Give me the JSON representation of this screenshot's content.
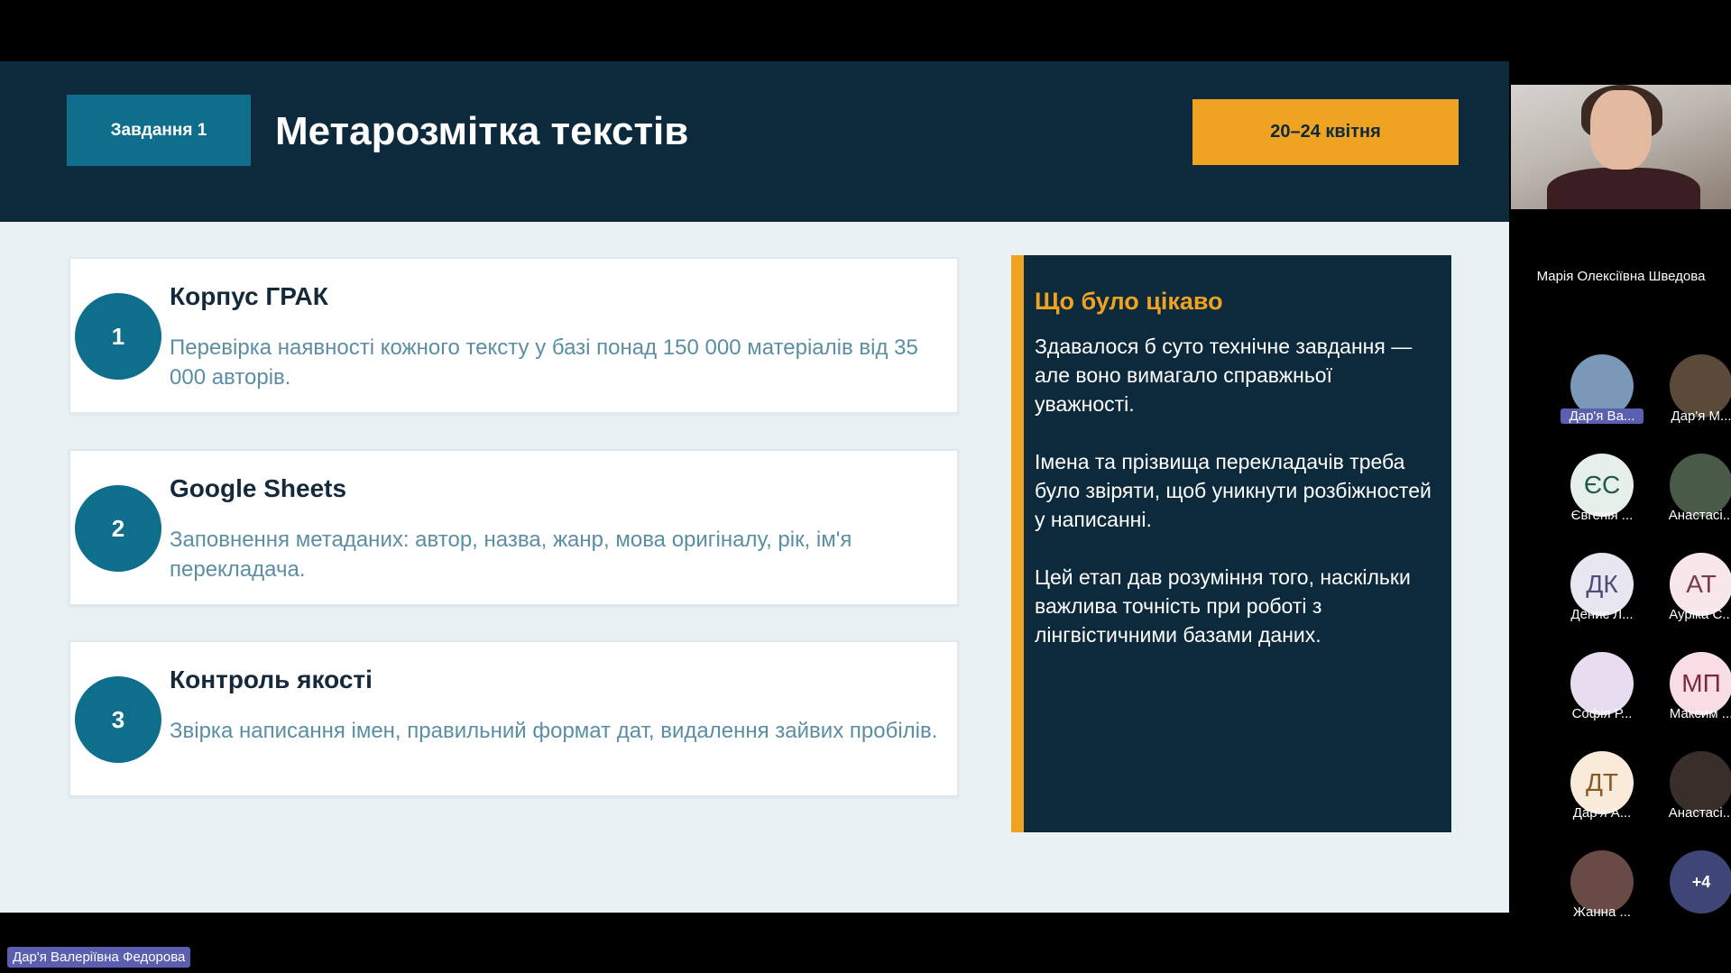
{
  "slide": {
    "task_badge": "Завдання 1",
    "title": "Метарозмітка текстів",
    "date_badge": "20–24 квітня",
    "cards": [
      {
        "num": "1",
        "title": "Корпус ГРАК",
        "desc": "Перевірка наявності кожного тексту у базі понад 150 000 матеріалів від 35 000 авторів."
      },
      {
        "num": "2",
        "title": "Google Sheets",
        "desc": "Заповнення метаданих: автор, назва, жанр, мова оригіналу, рік, ім'я перекладача."
      },
      {
        "num": "3",
        "title": "Контроль якості",
        "desc": "Звірка написання імен, правильний формат дат, видалення зайвих пробілів."
      }
    ],
    "side": {
      "title": "Що було цікаво",
      "paragraphs": [
        "Здавалося б суто технічне завдання — але воно вимагало справжньої уважності.",
        "Імена та прізвища перекладачів треба було звіряти, щоб уникнути розбіжностей у написанні.",
        "Цей етап дав розуміння того, наскільки важлива точність при роботі з лінгвістичними базами даних."
      ]
    }
  },
  "meeting": {
    "self_name": "Марія Олексіївна Шведова",
    "participants": [
      {
        "initials": "",
        "label": "Дар'я Ва...",
        "bg": "#7a98b8",
        "fg": "#fff",
        "highlight": true
      },
      {
        "initials": "",
        "label": "Дар'я М...",
        "bg": "#5b4a3a",
        "fg": "#fff",
        "highlight": false
      },
      {
        "initials": "ЄС",
        "label": "Євгенія ...",
        "bg": "#e6efe9",
        "fg": "#1f5a4a",
        "highlight": false
      },
      {
        "initials": "",
        "label": "Анастасі...",
        "bg": "#4a5a48",
        "fg": "#fff",
        "highlight": false
      },
      {
        "initials": "ДК",
        "label": "Денис Л...",
        "bg": "#e7e6f1",
        "fg": "#4a4d7a",
        "highlight": false
      },
      {
        "initials": "АТ",
        "label": "Ауріка С...",
        "bg": "#f7e6ea",
        "fg": "#7a3a4a",
        "highlight": false
      },
      {
        "initials": "",
        "label": "Софія Р...",
        "bg": "#e8ddf0",
        "fg": "#fff",
        "highlight": false
      },
      {
        "initials": "МП",
        "label": "Максим ...",
        "bg": "#f8dde4",
        "fg": "#7a2a3a",
        "highlight": false
      },
      {
        "initials": "ДТ",
        "label": "Дар'я А...",
        "bg": "#f9ead9",
        "fg": "#8a5a20",
        "highlight": false
      },
      {
        "initials": "",
        "label": "Анастасі...",
        "bg": "#3a2e2a",
        "fg": "#fff",
        "highlight": false
      },
      {
        "initials": "",
        "label": "Жанна ...",
        "bg": "#6a4a44",
        "fg": "#fff",
        "highlight": false
      },
      {
        "initials": "+4",
        "label": "",
        "bg": "#3f4576",
        "fg": "#fff",
        "highlight": false
      }
    ],
    "speaker_name": "Дар'я Валеріївна Федорова"
  }
}
